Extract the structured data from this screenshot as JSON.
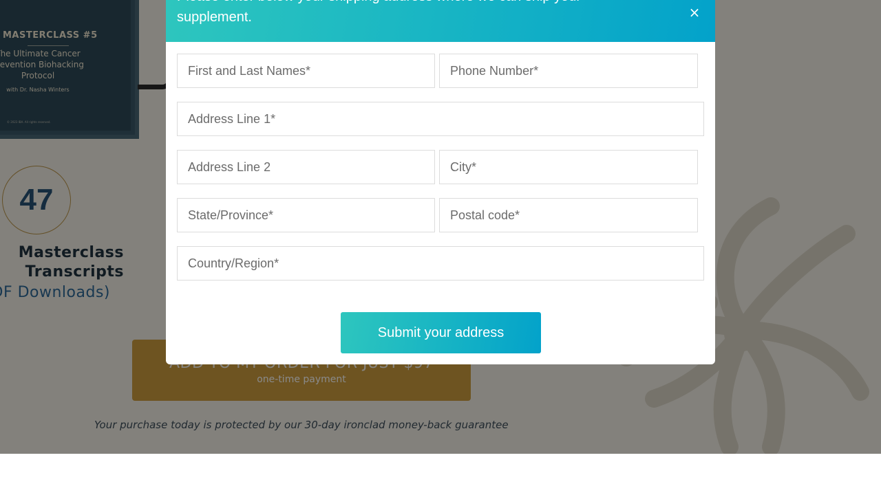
{
  "background": {
    "product": {
      "masterclass_title": "MASTERCLASS #5",
      "masterclass_subtitle_line1": "The Ultimate Cancer",
      "masterclass_subtitle_line2": "Prevention Biohacking",
      "masterclass_subtitle_line3": "Protocol",
      "masterclass_with": "with Dr. Nasha Winters",
      "copyright": "© 2023 IBA. All rights reserved."
    },
    "count": "47",
    "offer_title_line1": "Masterclass",
    "offer_title_line2": "Transcripts",
    "offer_subtitle": "(PDF Downloads)",
    "add_button": {
      "label": "ADD TO MY ORDER FOR JUST $97",
      "sublabel": "one-time payment"
    },
    "guarantee": "Your purchase today is protected by our 30-day ironclad money-back guarantee"
  },
  "modal": {
    "header": "Please enter below your shipping address where we can ship your supplement.",
    "close_icon": "×",
    "fields": {
      "name": {
        "placeholder": "First and Last Names*",
        "value": ""
      },
      "phone": {
        "placeholder": "Phone Number*",
        "value": ""
      },
      "address1": {
        "placeholder": "Address Line 1*",
        "value": ""
      },
      "address2": {
        "placeholder": "Address Line 2",
        "value": ""
      },
      "city": {
        "placeholder": "City*",
        "value": ""
      },
      "state": {
        "placeholder": "State/Province*",
        "value": ""
      },
      "postal": {
        "placeholder": "Postal code*",
        "value": ""
      },
      "country": {
        "placeholder": "Country/Region*",
        "value": ""
      }
    },
    "submit_label": "Submit your address"
  },
  "colors": {
    "accent_start": "#2ec6be",
    "accent_end": "#03a2ca",
    "gold": "#c9952f",
    "navy": "#17456a"
  }
}
